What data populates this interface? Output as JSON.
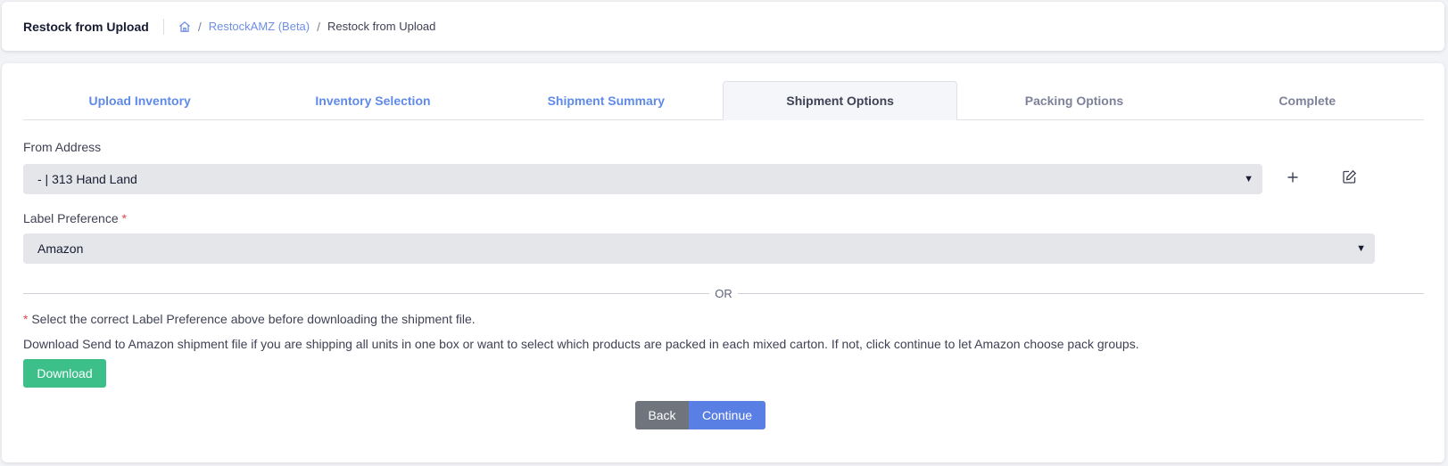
{
  "header": {
    "title": "Restock from Upload",
    "breadcrumb": {
      "home_icon": "home-icon",
      "parent": "RestockAMZ (Beta)",
      "current": "Restock from Upload"
    }
  },
  "tabs": [
    {
      "label": "Upload Inventory",
      "state": "done"
    },
    {
      "label": "Inventory Selection",
      "state": "done"
    },
    {
      "label": "Shipment Summary",
      "state": "done"
    },
    {
      "label": "Shipment Options",
      "state": "active"
    },
    {
      "label": "Packing Options",
      "state": "todo"
    },
    {
      "label": "Complete",
      "state": "todo"
    }
  ],
  "form": {
    "from_address": {
      "label": "From Address",
      "value": "- | 313 Hand Land",
      "add_icon": "plus-icon",
      "edit_icon": "edit-icon"
    },
    "label_preference": {
      "label": "Label Preference",
      "required_mark": "*",
      "value": "Amazon"
    },
    "or_text": "OR",
    "note_required": "Select the correct Label Preference above before downloading the shipment file.",
    "note_download": "Download Send to Amazon shipment file if you are shipping all units in one box or want to select which products are packed in each mixed carton. If not, click continue to let Amazon choose pack groups.",
    "download_label": "Download"
  },
  "footer": {
    "back_label": "Back",
    "continue_label": "Continue"
  },
  "colors": {
    "link_blue": "#6e8fe6",
    "download_green": "#3cbf88",
    "continue_blue": "#5a7fe4",
    "back_gray": "#70757d",
    "required_red": "#e14b4b"
  }
}
